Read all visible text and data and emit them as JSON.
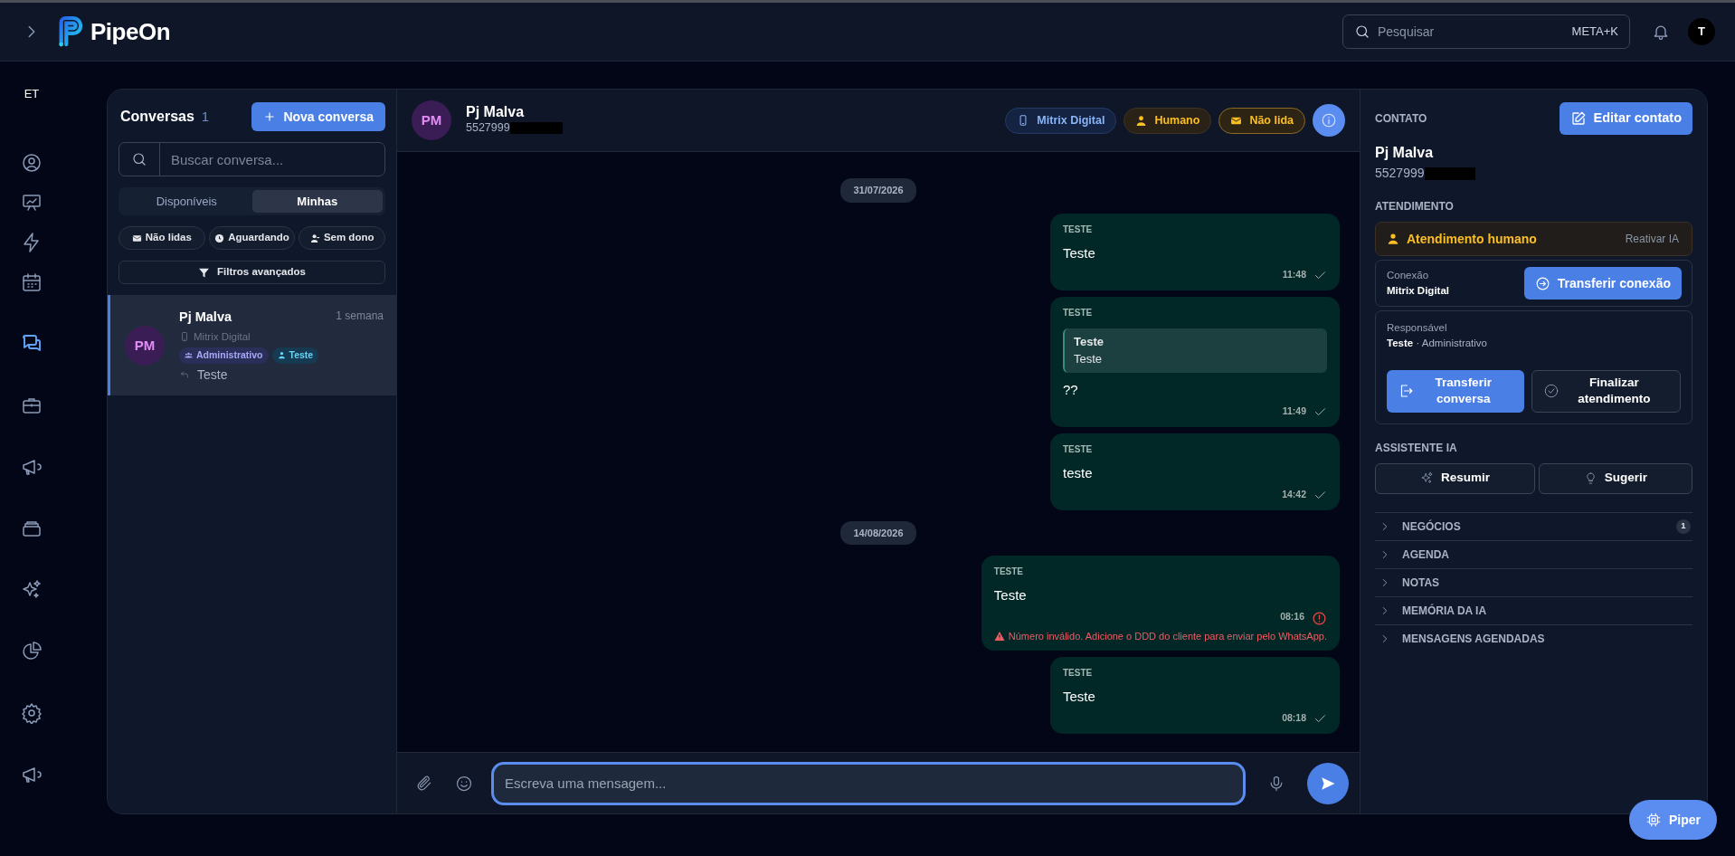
{
  "topbar": {
    "logo": "PipeOn",
    "search": {
      "placeholder": "Pesquisar",
      "shortcut": "META+K"
    },
    "avatar": "T"
  },
  "rail": {
    "label": "ET",
    "sections": [
      {
        "items": [
          {
            "selected": false
          },
          {
            "selected": false
          },
          {
            "selected": false
          },
          {
            "selected": false
          }
        ]
      },
      {
        "items": [
          {
            "selected": true
          },
          {
            "selected": false
          },
          {
            "selected": false
          },
          {
            "selected": false
          },
          {
            "selected": false
          },
          {
            "selected": false
          },
          {
            "selected": false
          },
          {
            "selected": false
          }
        ]
      }
    ]
  },
  "conversations": {
    "title": "Conversas",
    "count": "1",
    "new_button": "Nova conversa",
    "search": {
      "placeholder": "Buscar conversa..."
    },
    "tabs": [
      {
        "label": "Disponíveis",
        "selected": false
      },
      {
        "label": "Minhas",
        "selected": true
      }
    ],
    "filters": [
      {
        "label": "Não lidas",
        "kind": "unread"
      },
      {
        "label": "Aguardando",
        "kind": "waiting"
      },
      {
        "label": "Sem dono",
        "kind": "unowned"
      }
    ],
    "advanced_filters": "Filtros avançados",
    "items": [
      {
        "initials": "PM",
        "name": "Pj Malva",
        "time": "1 semana",
        "connection": "Mitrix Digital",
        "tags": [
          {
            "label": "Administrativo",
            "kind": "team",
            "color": "#a5a8f7"
          },
          {
            "label": "Teste",
            "kind": "user",
            "color": "#67d3f5"
          }
        ],
        "preview": "Teste",
        "selected": true
      }
    ]
  },
  "chat": {
    "contact": {
      "initials": "PM",
      "name": "Pj Malva",
      "phone": "5527999",
      "redacted": true
    },
    "badges": [
      {
        "label": "Mitrix Digital",
        "kind": "connection"
      },
      {
        "label": "Humano",
        "kind": "mode"
      },
      {
        "label": "Não lida",
        "kind": "status"
      }
    ],
    "messages": [
      {
        "kind": "date",
        "text": "31/07/2026"
      },
      {
        "kind": "outgoing",
        "sender": "TESTE",
        "text": "Teste",
        "time": "11:48",
        "failed": false
      },
      {
        "kind": "outgoing",
        "sender": "TESTE",
        "quote": {
          "title": "Teste",
          "text": "Teste"
        },
        "text": "??",
        "time": "11:49",
        "failed": false
      },
      {
        "kind": "outgoing",
        "sender": "TESTE",
        "text": "teste",
        "time": "14:42",
        "failed": false
      },
      {
        "kind": "date",
        "text": "14/08/2026"
      },
      {
        "kind": "outgoing",
        "sender": "TESTE",
        "text": "Teste",
        "time": "08:16",
        "failed": true,
        "error": "Número inválido. Adicione o DDD do cliente para enviar pelo WhatsApp."
      },
      {
        "kind": "outgoing",
        "sender": "TESTE",
        "text": "Teste",
        "time": "08:18",
        "failed": false
      }
    ],
    "composer": {
      "placeholder": "Escreva uma mensagem..."
    }
  },
  "details": {
    "contact_title": "CONTATO",
    "edit_button": "Editar contato",
    "name": "Pj Malva",
    "phone": "5527999",
    "redacted": true,
    "service_title": "ATENDIMENTO",
    "mode": {
      "label": "Atendimento humano",
      "action": "Reativar IA"
    },
    "connection": {
      "label": "Conexão",
      "value": "Mitrix Digital",
      "button": "Transferir conexão"
    },
    "responsible": {
      "label": "Responsável",
      "name": "Teste",
      "team": "· Administrativo"
    },
    "actions": [
      {
        "label": "Transferir conversa",
        "kind": "primary"
      },
      {
        "label": "Finalizar atendimento",
        "kind": "outline"
      }
    ],
    "ai_title": "ASSISTENTE IA",
    "ai_actions": [
      {
        "label": "Resumir"
      },
      {
        "label": "Sugerir"
      }
    ],
    "sections": [
      {
        "label": "NEGÓCIOS",
        "count": "1",
        "expanded": false
      },
      {
        "label": "AGENDA",
        "expanded": false
      },
      {
        "label": "NOTAS",
        "expanded": false
      },
      {
        "label": "MEMÓRIA DA IA",
        "expanded": false
      },
      {
        "label": "MENSAGENS AGENDADAS",
        "expanded": false
      }
    ]
  },
  "assistant_button": "Piper"
}
